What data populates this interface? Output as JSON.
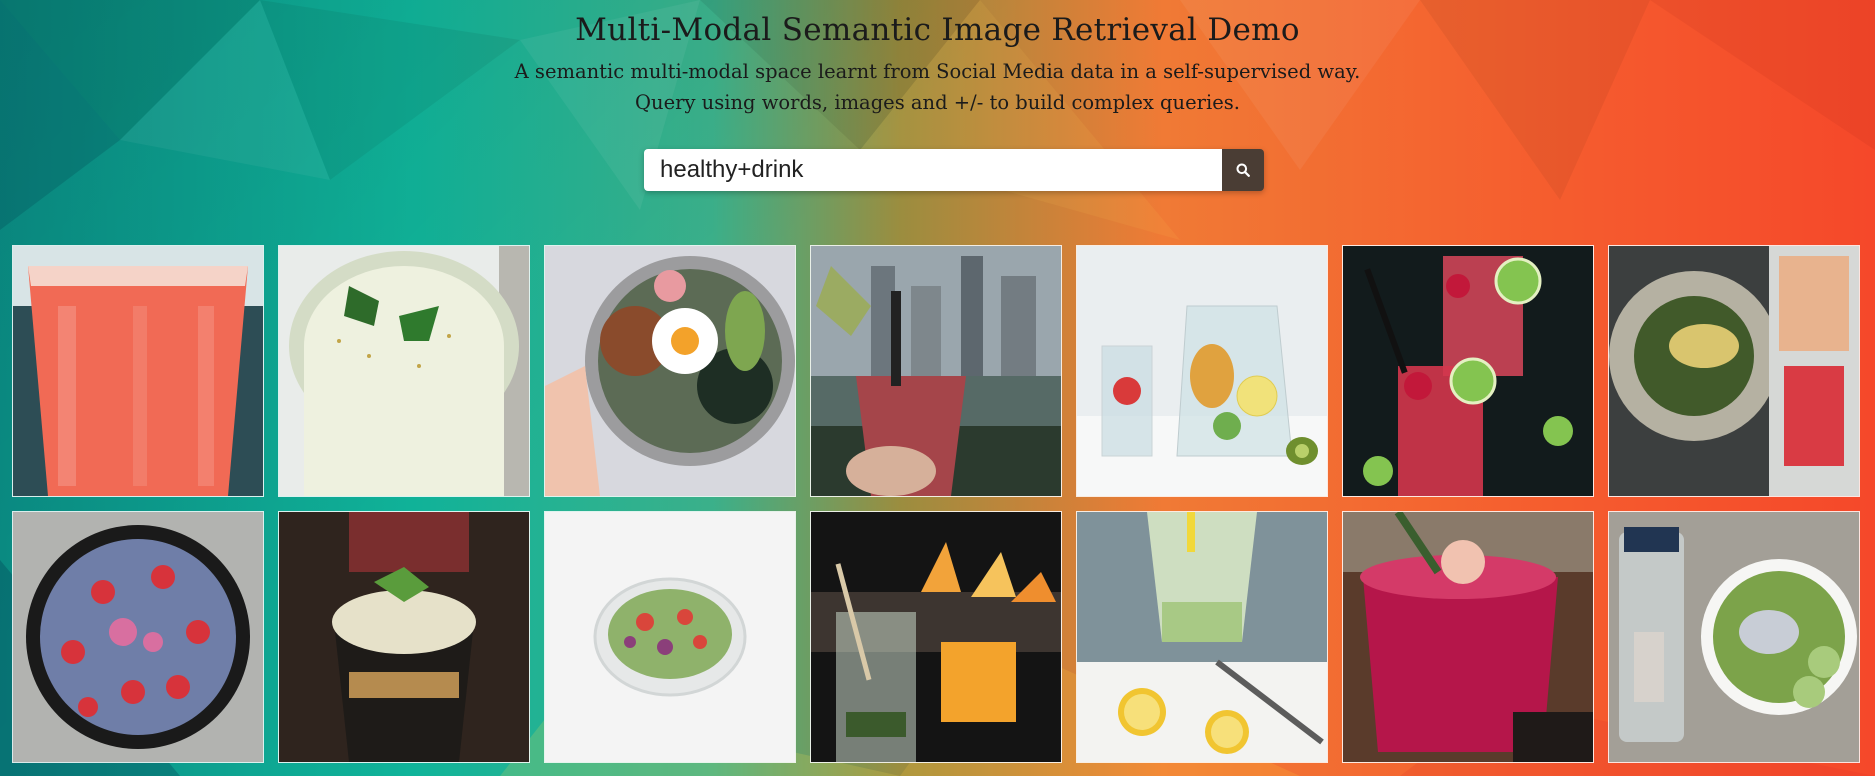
{
  "header": {
    "title": "Multi-Modal Semantic Image Retrieval Demo",
    "subtitle_line1": "A semantic multi-modal space learnt from Social Media data in a self-supervised way.",
    "subtitle_line2": "Query using words, images and +/- to build complex queries."
  },
  "search": {
    "value": "healthy+drink",
    "button_icon": "search-icon"
  },
  "results": {
    "rows": 2,
    "columns": 7,
    "items": [
      "pink-drink-glass",
      "smoothie-with-parsley",
      "rice-bowl-with-egg",
      "cocktail-city-view",
      "fruit-water-pitcher",
      "berry-lime-cocktails",
      "salad-with-juices",
      "berry-bowl",
      "mint-iced-coffee-cup",
      "salad-bowl-white",
      "drinks-by-fire",
      "green-juice-lemons",
      "red-cocktail-rosemary",
      "edamame-poke-bowl"
    ]
  },
  "colors": {
    "bg_left": "#0fa596",
    "bg_right": "#f5482a",
    "search_button": "#4a3d34"
  }
}
